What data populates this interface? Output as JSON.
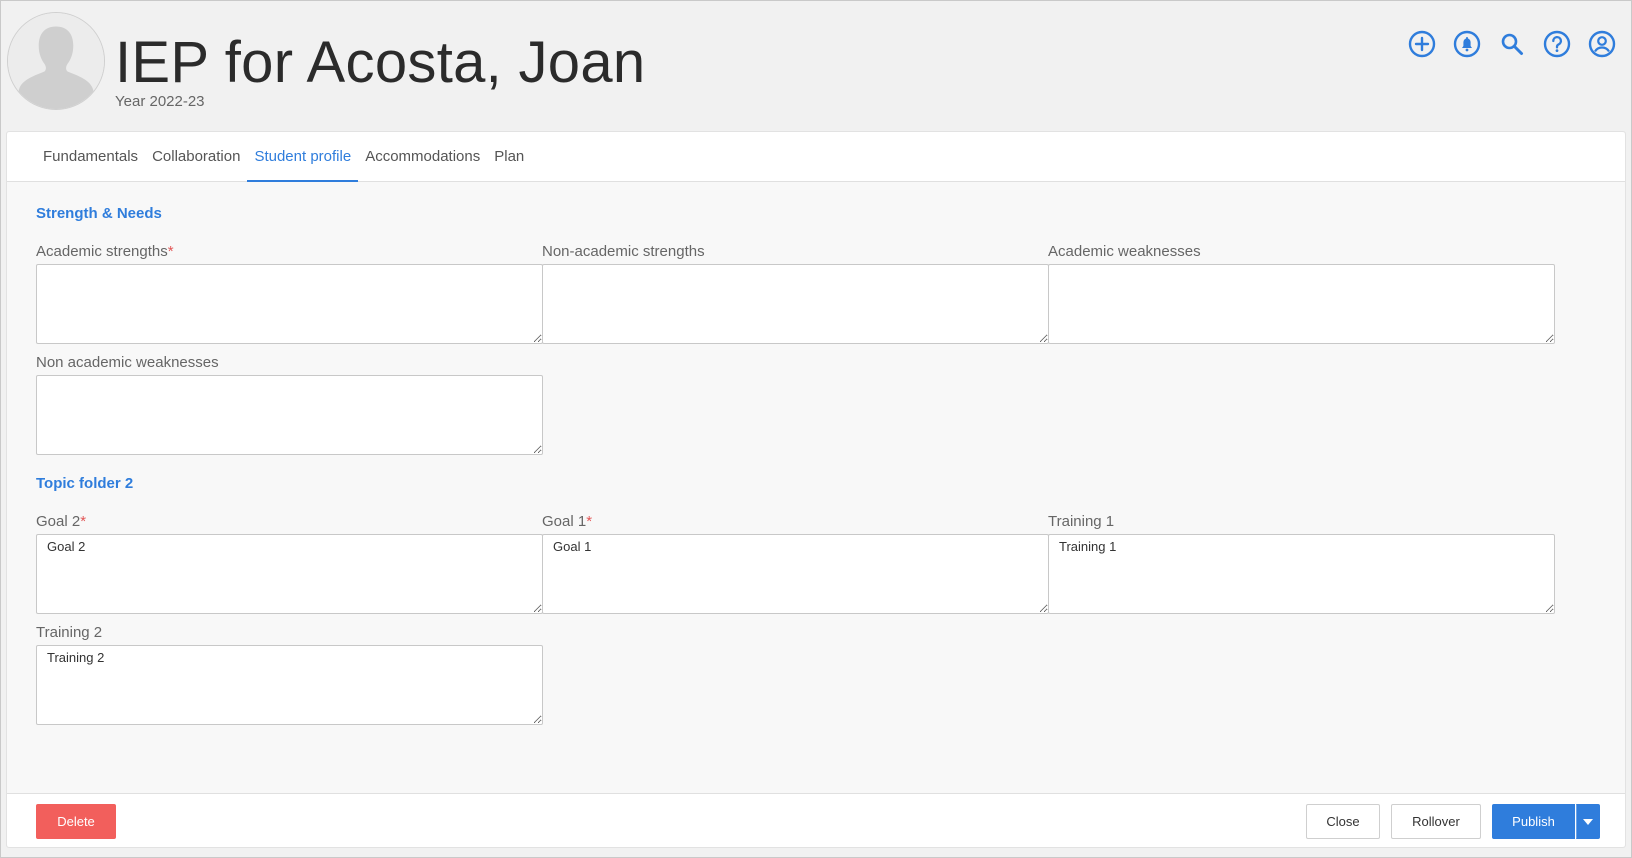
{
  "header": {
    "title": "IEP for Acosta, Joan",
    "subtitle": "Year 2022-23",
    "icons": [
      "add-circle-icon",
      "bell-icon",
      "search-icon",
      "help-icon",
      "account-icon"
    ]
  },
  "tabs": [
    {
      "label": "Fundamentals"
    },
    {
      "label": "Collaboration"
    },
    {
      "label": "Student profile",
      "active": true
    },
    {
      "label": "Accommodations"
    },
    {
      "label": "Plan"
    }
  ],
  "sections": [
    {
      "title": "Strength & Needs",
      "fields": [
        {
          "label": "Academic strengths",
          "required": "*",
          "value": ""
        },
        {
          "label": "Non-academic strengths",
          "required": "",
          "value": ""
        },
        {
          "label": "Academic weaknesses",
          "required": "",
          "value": ""
        },
        {
          "label": "Non academic weaknesses",
          "required": "",
          "value": ""
        }
      ]
    },
    {
      "title": "Topic folder 2",
      "fields": [
        {
          "label": "Goal 2",
          "required": "*",
          "value": "Goal 2"
        },
        {
          "label": "Goal 1",
          "required": "*",
          "value": "Goal 1"
        },
        {
          "label": "Training 1",
          "required": "",
          "value": "Training 1"
        },
        {
          "label": "Training 2",
          "required": "",
          "value": "Training 2"
        }
      ]
    }
  ],
  "footer": {
    "delete_label": "Delete",
    "close_label": "Close",
    "rollover_label": "Rollover",
    "publish_label": "Publish"
  },
  "colors": {
    "accent": "#2f7ddc",
    "danger": "#f25f5c",
    "required": "#e25656"
  }
}
